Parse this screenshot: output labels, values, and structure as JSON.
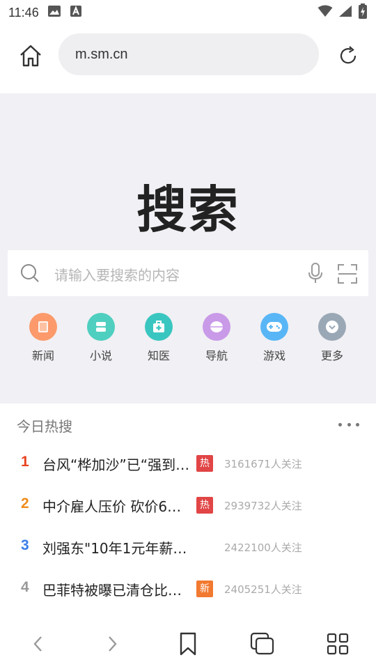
{
  "status_bar": {
    "time": "11:46",
    "icons": [
      "image-icon",
      "font-icon",
      "wifi-icon",
      "signal-icon",
      "battery-charging-icon"
    ]
  },
  "address_bar": {
    "home_icon": "home-icon",
    "url": "m.sm.cn",
    "reload_icon": "reload-icon"
  },
  "hero": {
    "logo_text": "搜索",
    "search_placeholder": "请输入要搜索的内容",
    "mic_icon": "mic-icon",
    "scan_icon": "scan-icon"
  },
  "quick_links": [
    {
      "label": "新闻",
      "icon": "news-icon",
      "color": "#fc9a6b"
    },
    {
      "label": "小说",
      "icon": "novel-icon",
      "color": "#4fcfbf"
    },
    {
      "label": "知医",
      "icon": "medical-icon",
      "color": "#3ac6c0"
    },
    {
      "label": "导航",
      "icon": "navigation-icon",
      "color": "#c99ae8"
    },
    {
      "label": "游戏",
      "icon": "game-icon",
      "color": "#59b6f6"
    },
    {
      "label": "更多",
      "icon": "more-icon",
      "color": "#9aa8b6"
    }
  ],
  "hot_list": {
    "title": "今日热搜",
    "items": [
      {
        "rank": "1",
        "rank_color": "#e8421f",
        "text": "台风“桦加沙”已“强到…",
        "badge": "热",
        "badge_color": "#e14545",
        "count": "3161671人关注"
      },
      {
        "rank": "2",
        "rank_color": "#f08c1c",
        "text": "中介雇人压价 砍价6…",
        "badge": "热",
        "badge_color": "#e14545",
        "count": "2939732人关注"
      },
      {
        "rank": "3",
        "rank_color": "#3a7ee8",
        "text": "刘强东\"10年1元年薪…",
        "badge": "",
        "badge_color": "",
        "count": "2422100人关注"
      },
      {
        "rank": "4",
        "rank_color": "#999999",
        "text": "巴菲特被曝已清仓比…",
        "badge": "新",
        "badge_color": "#f27930",
        "count": "2405251人关注"
      }
    ]
  },
  "bottom_nav": [
    {
      "name": "back-button",
      "icon": "chevron-left-icon"
    },
    {
      "name": "forward-button",
      "icon": "chevron-right-icon"
    },
    {
      "name": "bookmarks-button",
      "icon": "bookmark-icon"
    },
    {
      "name": "tabs-button",
      "icon": "tabs-icon"
    },
    {
      "name": "menu-button",
      "icon": "grid-icon"
    }
  ]
}
